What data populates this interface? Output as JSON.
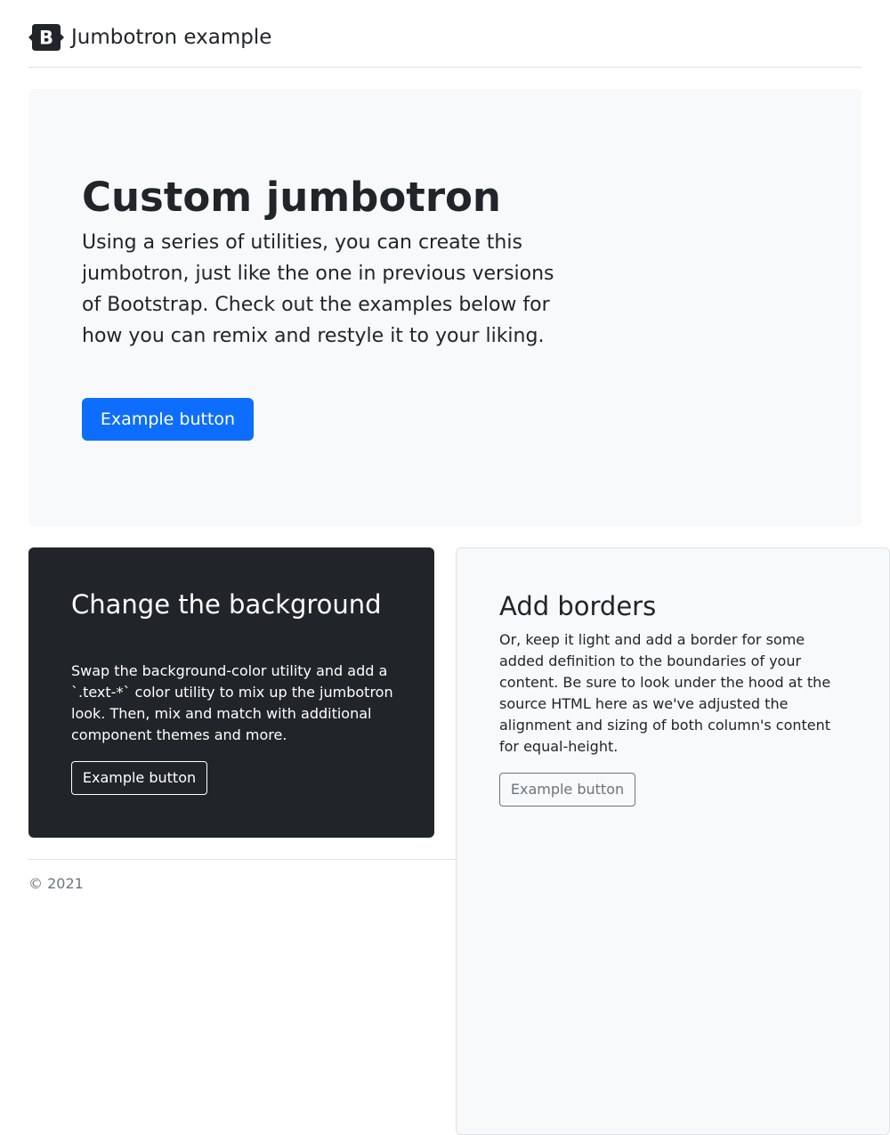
{
  "header": {
    "brand_text": "Jumbotron example",
    "logo_letter": "B",
    "logo_icon": "bootstrap-logo-icon"
  },
  "hero": {
    "title": "Custom jumbotron",
    "lead": "Using a series of utilities, you can create this jumbotron, just like the one in previous versions of Bootstrap. Check out the examples below for how you can remix and restyle it to your liking.",
    "button_label": "Example button"
  },
  "dark_card": {
    "title": "Change the background",
    "text": "Swap the background-color utility and add a `.text-*` color utility to mix up the jumbotron look. Then, mix and match with additional component themes and more.",
    "button_label": "Example button"
  },
  "light_card": {
    "title": "Add borders",
    "text": "Or, keep it light and add a border for some added definition to the boundaries of your content. Be sure to look under the hood at the source HTML here as we've adjusted the alignment and sizing of both column's content for equal-height.",
    "button_label": "Example button"
  },
  "footer": {
    "copyright": "© 2021"
  },
  "colors": {
    "primary": "#0d6efd",
    "dark": "#212529",
    "light_bg": "#f8f9fa",
    "border": "#dee2e6",
    "muted": "#6c757d"
  }
}
